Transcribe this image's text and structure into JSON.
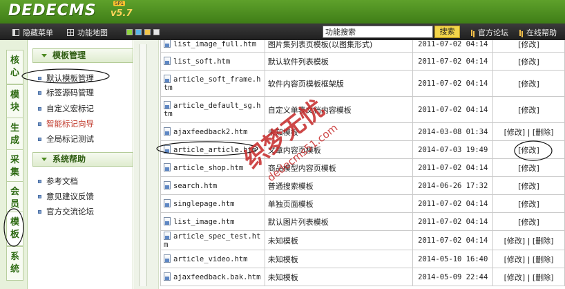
{
  "app": {
    "logo_text": "DEDECMS",
    "version": "v5.7",
    "badge": "SP1"
  },
  "toolbar": {
    "hide_menu": "隐藏菜单",
    "function_map": "功能地图",
    "search_value": "功能搜索",
    "search_button": "搜索",
    "forum": "官方论坛",
    "help": "在线帮助"
  },
  "left_tabs": [
    "核心",
    "模块",
    "生成",
    "采集",
    "会员",
    "模板",
    "系统"
  ],
  "active_tab": "模板",
  "menu": {
    "group1": {
      "title": "模板管理",
      "items": [
        "默认模板管理",
        "标签源码管理",
        "自定义宏标记",
        "智能标记向导",
        "全局标记测试"
      ]
    },
    "group2": {
      "title": "系统帮助",
      "items": [
        "参考文档",
        "意见建议反馈",
        "官方交流论坛"
      ]
    }
  },
  "table": {
    "rows": [
      {
        "file": "list_image_full.htm",
        "desc": "图片集列表页模板(以图集形式)",
        "time": "2011-07-02 04:14",
        "action": "[修改]"
      },
      {
        "file": "list_soft.htm",
        "desc": "默认软件列表模板",
        "time": "2011-07-02 04:14",
        "action": "[修改]"
      },
      {
        "file": "article_soft_frame.htm",
        "desc": "软件内容页模板框架版",
        "time": "2011-07-02 04:14",
        "action": "[修改]"
      },
      {
        "file": "article_default_sg.htm",
        "desc": "自定义单表文档内容模板",
        "time": "2011-07-02 04:14",
        "action": "[修改]"
      },
      {
        "file": "ajaxfeedback2.htm",
        "desc": "未知模板",
        "time": "2014-03-08 01:34",
        "action": "[修改] | [删除]"
      },
      {
        "file": "article_article.htm",
        "desc": "文章内容页模板",
        "time": "2014-07-03 19:49",
        "action": "[修改]"
      },
      {
        "file": "article_shop.htm",
        "desc": "商品模型内容页模板",
        "time": "2011-07-02 04:14",
        "action": "[修改]"
      },
      {
        "file": "search.htm",
        "desc": "普通搜索模板",
        "time": "2014-06-26 17:32",
        "action": "[修改]"
      },
      {
        "file": "singlepage.htm",
        "desc": "单独页面模板",
        "time": "2011-07-02 04:14",
        "action": "[修改]"
      },
      {
        "file": "list_image.htm",
        "desc": "默认图片列表模板",
        "time": "2011-07-02 04:14",
        "action": "[修改]"
      },
      {
        "file": "article_spec_test.htm",
        "desc": "未知模板",
        "time": "2011-07-02 04:14",
        "action": "[修改] | [删除]"
      },
      {
        "file": "article_video.htm",
        "desc": "未知模板",
        "time": "2014-05-10 16:40",
        "action": "[修改] | [删除]"
      },
      {
        "file": "ajaxfeedback.bak.htm",
        "desc": "未知模板",
        "time": "2014-05-09 22:44",
        "action": "[修改] | [删除]"
      }
    ]
  },
  "watermark": {
    "line1": "织梦无忧",
    "line2": "dedecms51.com"
  },
  "colors": {
    "header_green": "#4a8c1f",
    "toolbar_dark": "#2a2a2a",
    "search_button": "#f3d54a",
    "menu_head_text": "#2f5d12",
    "watermark_red": "#c62828"
  }
}
